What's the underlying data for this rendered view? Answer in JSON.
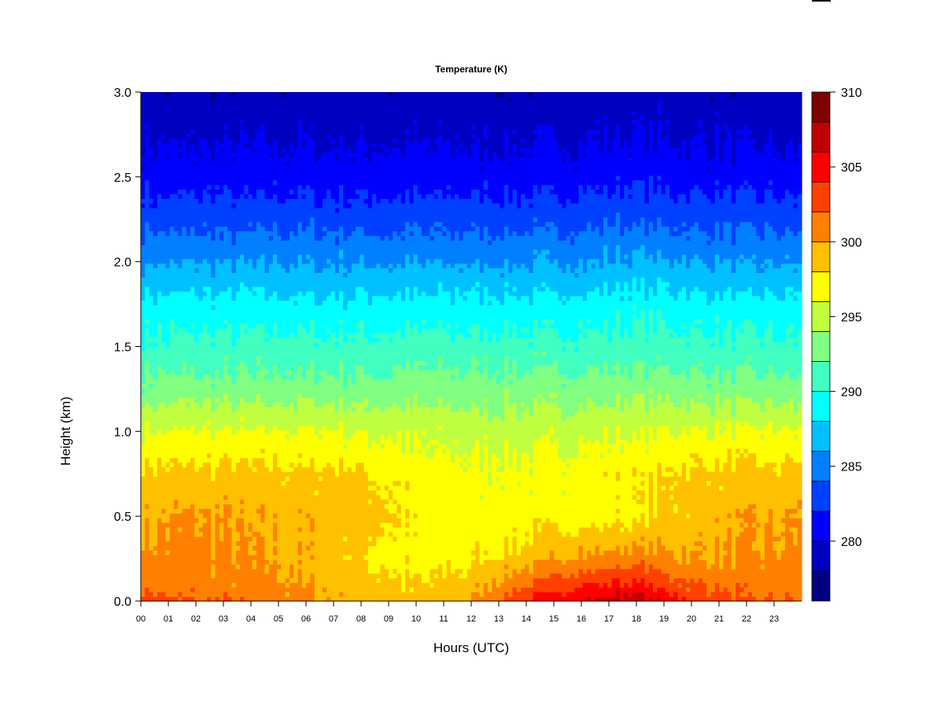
{
  "chart_data": {
    "type": "heatmap",
    "title": "Temperature (K)",
    "xlabel": "Hours (UTC)",
    "ylabel": "Height (km)",
    "xlim": [
      0,
      24
    ],
    "ylim": [
      0,
      3.0
    ],
    "x_tick_labels": [
      "00",
      "01",
      "02",
      "03",
      "04",
      "05",
      "06",
      "07",
      "08",
      "09",
      "10",
      "11",
      "12",
      "13",
      "14",
      "15",
      "16",
      "17",
      "18",
      "19",
      "20",
      "21",
      "22",
      "23"
    ],
    "y_tick_labels": [
      "0.0",
      "0.5",
      "1.0",
      "1.5",
      "2.0",
      "2.5",
      "3.0"
    ],
    "colorbar": {
      "min": 276,
      "max": 310,
      "step": 2,
      "tick_labels": [
        "280",
        "285",
        "290",
        "295",
        "300",
        "305",
        "310"
      ],
      "colors": [
        "#000080",
        "#0000C0",
        "#0000FF",
        "#0040FF",
        "#0080FF",
        "#00C0FF",
        "#00FFFF",
        "#40FFC0",
        "#80FF80",
        "#C0FF40",
        "#FFFF00",
        "#FFC000",
        "#FF8000",
        "#FF4000",
        "#FF0000",
        "#C00000",
        "#800000"
      ]
    },
    "grid_hours": [
      0,
      2,
      4,
      6,
      8,
      10,
      12,
      14,
      16,
      18,
      20,
      22,
      24
    ],
    "grid_heights_km": [
      0,
      0.1,
      0.25,
      0.5,
      0.75,
      1.0,
      1.25,
      1.5,
      1.75,
      2.0,
      2.25,
      2.5,
      2.75,
      3.0
    ],
    "temperature_K": [
      [
        303,
        302,
        301.5,
        300.5,
        299.5,
        298.5,
        300,
        304,
        306,
        307.5,
        304,
        302,
        302
      ],
      [
        301,
        301,
        300.5,
        300,
        299,
        298,
        299,
        302,
        304,
        304.5,
        302,
        301,
        301
      ],
      [
        300.5,
        300.5,
        300,
        299.5,
        298,
        297,
        297.5,
        299,
        300.5,
        301,
        300,
        300,
        300.5
      ],
      [
        299.5,
        300.2,
        299.5,
        299.5,
        299.3,
        297.5,
        297,
        297,
        297.2,
        297.5,
        299,
        299.5,
        300.2
      ],
      [
        298.5,
        298.5,
        298.5,
        298.5,
        298.3,
        297,
        296.5,
        296.5,
        297,
        297.5,
        298.5,
        298.5,
        298.5
      ],
      [
        296.2,
        296.2,
        296.2,
        296.2,
        296,
        295.5,
        295.3,
        295.3,
        295.5,
        295.8,
        296.2,
        296.2,
        296.2
      ],
      [
        292.8,
        292.8,
        292.8,
        292.8,
        292.8,
        293,
        293,
        293,
        293,
        293.2,
        293,
        292.8,
        292.8
      ],
      [
        290.6,
        290.6,
        290.6,
        290.6,
        290.6,
        290.8,
        290.8,
        290.8,
        290.8,
        291,
        290.8,
        290.6,
        290.6
      ],
      [
        288.6,
        288.6,
        288.6,
        288.6,
        288.6,
        288.7,
        288.7,
        288.7,
        288.8,
        289,
        288.8,
        288.6,
        288.6
      ],
      [
        285.8,
        285.8,
        285.8,
        285.8,
        285.8,
        285.8,
        285.8,
        285.8,
        285.9,
        286.5,
        286,
        285.8,
        285.8
      ],
      [
        283.2,
        283.2,
        283.2,
        283.2,
        283.2,
        283.2,
        283.2,
        283.2,
        283.4,
        283.8,
        283.4,
        283.2,
        283.2
      ],
      [
        281,
        281,
        281,
        281,
        281,
        281,
        281,
        281,
        281.2,
        281.5,
        281.2,
        281,
        281
      ],
      [
        279.6,
        279.6,
        279.6,
        279.6,
        279.6,
        279.6,
        279.6,
        279.6,
        279.8,
        280,
        279.8,
        279.6,
        279.6
      ],
      [
        278.5,
        278.5,
        278.5,
        278.5,
        278.5,
        278.5,
        278.5,
        278.5,
        278.8,
        279,
        278.8,
        278.5,
        278.5
      ]
    ]
  }
}
